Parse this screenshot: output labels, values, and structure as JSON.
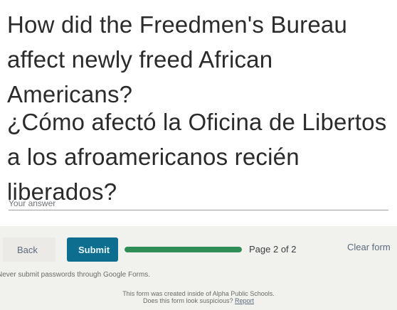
{
  "question": {
    "english": "How did the Freedmen's Bureau affect newly freed African Americans?",
    "spanish": "¿Cómo afectó la Oficina de Libertos a los afroamericanos recién liberados?"
  },
  "answer": {
    "placeholder": "Your answer",
    "value": ""
  },
  "navigation": {
    "back_label": "Back",
    "submit_label": "Submit",
    "progress_fraction": 1.0,
    "page_label": "Page 2 of 2",
    "clear_label": "Clear form"
  },
  "warning_text": "Never submit passwords through Google Forms.",
  "footer": {
    "created_text": "This form was created inside of Alpha Public Schools.",
    "suspicious_text": "Does this form look suspicious?",
    "report_label": "Report"
  },
  "colors": {
    "submit": "#0d6e8f",
    "progress": "#2f8e57"
  }
}
